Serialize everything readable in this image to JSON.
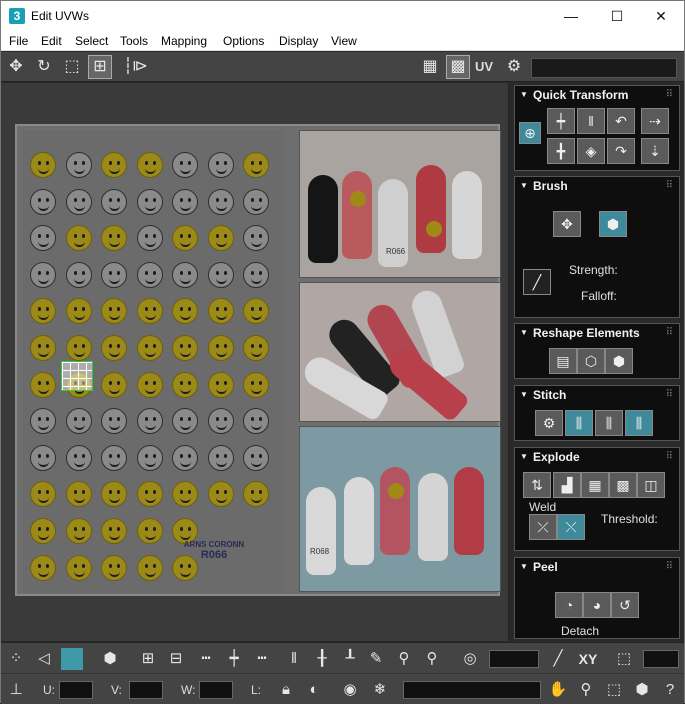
{
  "window": {
    "title": "Edit UVWs",
    "app_icon": "3",
    "minimize": "—",
    "maximize": "☐",
    "close": "✕"
  },
  "menu": [
    "File",
    "Edit",
    "Select",
    "Tools",
    "Mapping",
    "Options",
    "Display",
    "View"
  ],
  "top_toolbar": {
    "uv_label": "UV",
    "icons": [
      "move-icon",
      "rotate-icon",
      "scale-icon",
      "freeform-icon",
      "mirror-icon",
      "checker-icon",
      "grid-icon",
      "settings-icon"
    ]
  },
  "viewport": {
    "sheet_logo": "ARNS CORONN",
    "sheet_code": "R066",
    "photo_code": "R066",
    "photo_code_2": "R068"
  },
  "panel": {
    "quick_transform": {
      "title": "Quick Transform"
    },
    "brush": {
      "title": "Brush",
      "strength_label": "Strength:",
      "falloff_label": "Falloff:"
    },
    "reshape": {
      "title": "Reshape Elements"
    },
    "stitch": {
      "title": "Stitch"
    },
    "explode": {
      "title": "Explode",
      "weld_label": "Weld",
      "threshold_label": "Threshold:"
    },
    "peel": {
      "title": "Peel",
      "detach_label": "Detach"
    }
  },
  "bottom": {
    "xy_label": "XY",
    "u_label": "U:",
    "v_label": "V:",
    "w_label": "W:",
    "l_label": "L:"
  },
  "colors": {
    "accent": "#3e8a9a",
    "selection": "#33cc33",
    "smiley_yellow": "#9c8a18"
  }
}
